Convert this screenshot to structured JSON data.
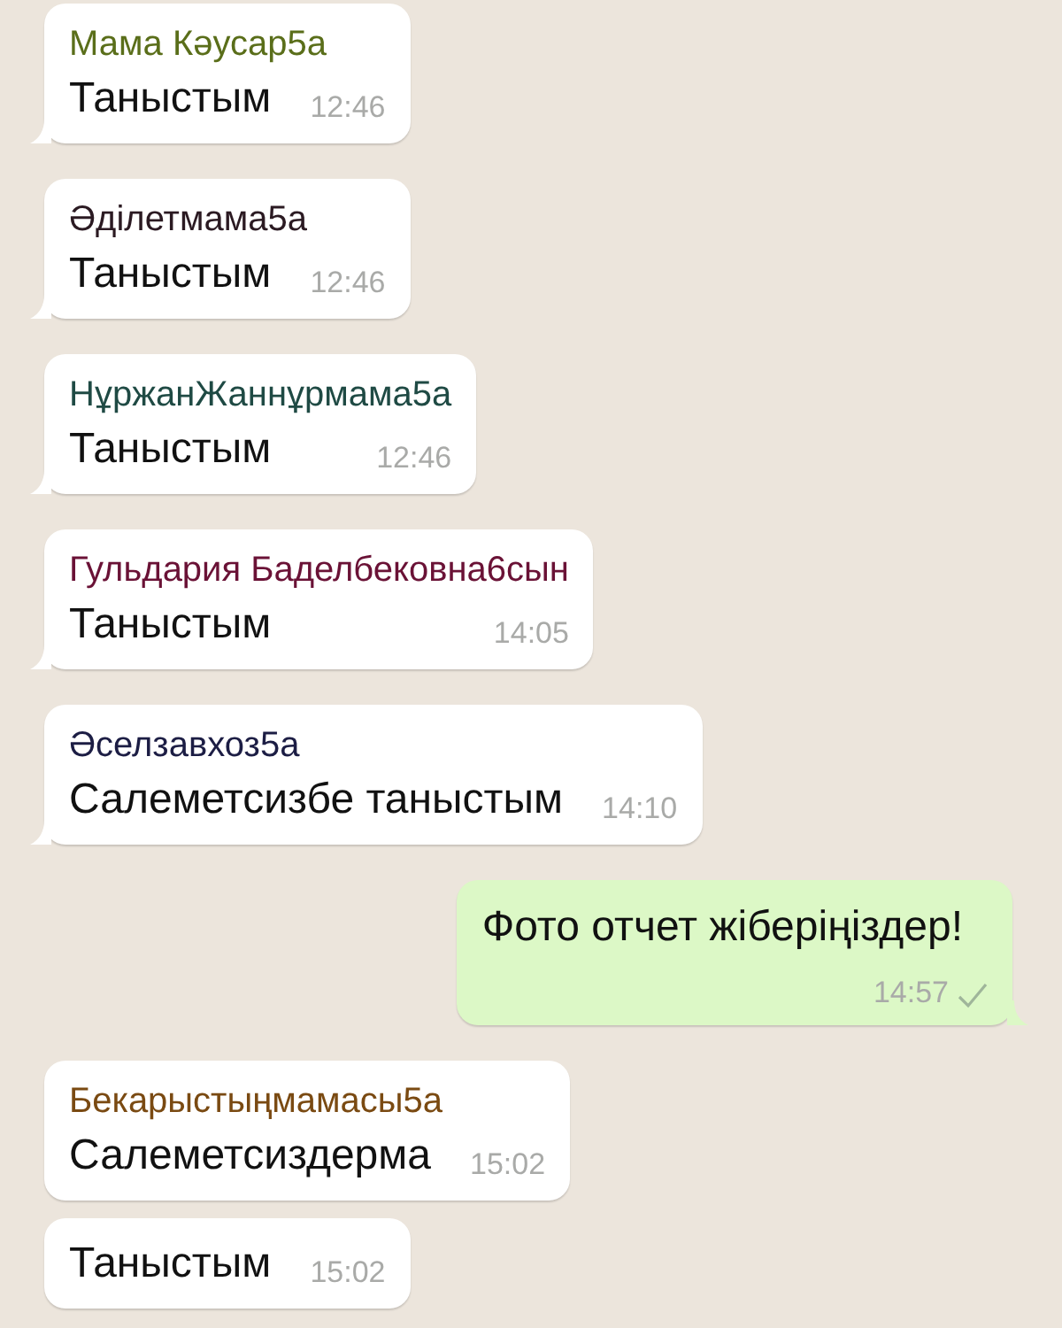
{
  "messages": [
    {
      "kind": "incoming",
      "sender": "Мама Кәусар5а",
      "color": "#5a6e1a",
      "text": "Таныстым",
      "time": "12:46",
      "tail": true
    },
    {
      "kind": "incoming",
      "sender": "Әділетмама5а",
      "color": "#2b1a22",
      "text": "Таныстым",
      "time": "12:46",
      "tail": true
    },
    {
      "kind": "incoming",
      "sender": "НұржанЖаннұрмама5а",
      "color": "#1f4a44",
      "text": "Таныстым",
      "time": "12:46",
      "tail": true
    },
    {
      "kind": "incoming",
      "sender": "Гульдария Баделбековна6сын",
      "color": "#6a1236",
      "text": "Таныстым",
      "time": "14:05",
      "tail": true
    },
    {
      "kind": "incoming",
      "sender": "Әселзавхоз5а",
      "color": "#1c1d44",
      "text": "Салеметсизбе таныстым",
      "time": "14:10",
      "tail": true
    },
    {
      "kind": "outgoing",
      "text": "Фото отчет жіберіңіздер!",
      "time": "14:57",
      "tail": true,
      "delivered": true
    },
    {
      "kind": "incoming",
      "sender": "Бекарыстыңмамасы5а",
      "color": "#7a4a12",
      "text": "Салеметсиздерма",
      "time": "15:02",
      "tail": false
    },
    {
      "kind": "incoming",
      "text": "Таныстым",
      "time": "15:02",
      "tail": false
    }
  ]
}
